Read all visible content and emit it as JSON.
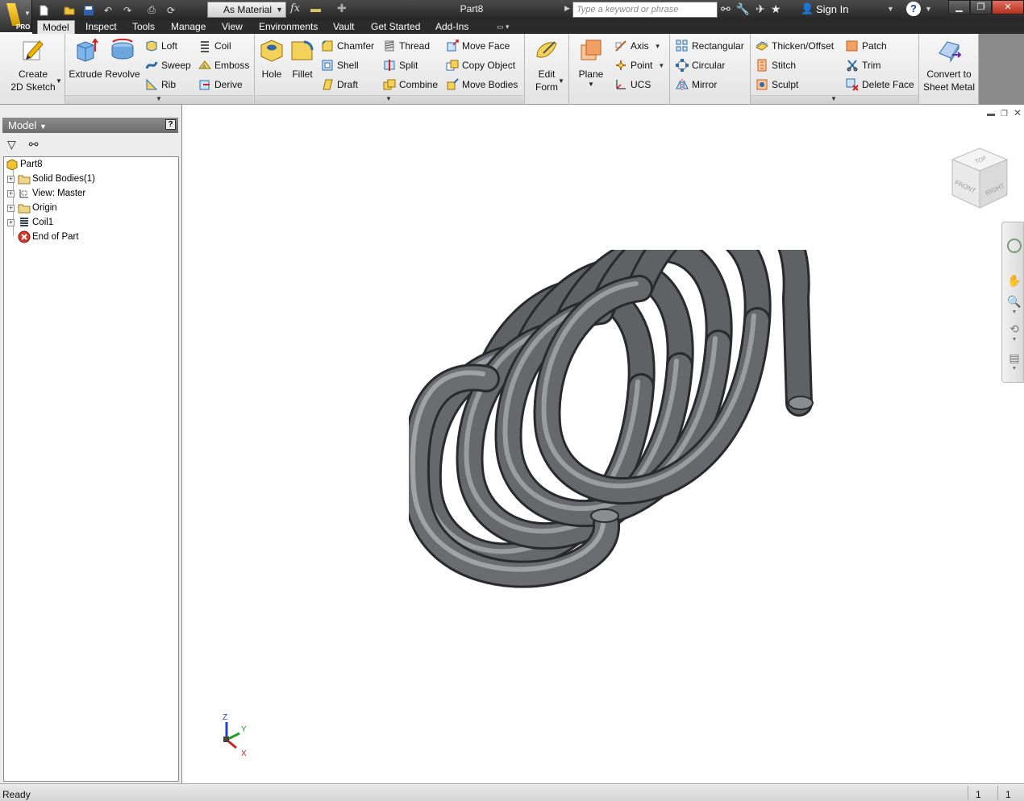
{
  "app": {
    "edition": "PRO",
    "document_title": "Part8"
  },
  "quick_access": {
    "material": "As Material",
    "search_placeholder": "Type a keyword or phrase",
    "sign_in": "Sign In",
    "help": "?"
  },
  "tabs": [
    "Model",
    "Inspect",
    "Tools",
    "Manage",
    "View",
    "Environments",
    "Vault",
    "Get Started",
    "Add-Ins"
  ],
  "ribbon": {
    "sketch": {
      "create": "Create\n2D Sketch"
    },
    "create": {
      "extrude": "Extrude",
      "revolve": "Revolve",
      "loft": "Loft",
      "sweep": "Sweep",
      "rib": "Rib",
      "coil": "Coil",
      "emboss": "Emboss",
      "derive": "Derive"
    },
    "modify": {
      "hole": "Hole",
      "fillet": "Fillet",
      "chamfer": "Chamfer",
      "shell": "Shell",
      "draft": "Draft",
      "thread": "Thread",
      "split": "Split",
      "combine": "Combine",
      "move_face": "Move Face",
      "copy_object": "Copy Object",
      "move_bodies": "Move Bodies"
    },
    "freeform": {
      "edit_form": "Edit\nForm"
    },
    "work_features": {
      "plane": "Plane",
      "axis": "Axis",
      "point": "Point",
      "ucs": "UCS"
    },
    "pattern": {
      "rectangular": "Rectangular",
      "circular": "Circular",
      "mirror": "Mirror"
    },
    "surface": {
      "thicken_offset": "Thicken/Offset",
      "stitch": "Stitch",
      "sculpt": "Sculpt",
      "patch": "Patch",
      "trim": "Trim",
      "delete_face": "Delete Face"
    },
    "convert": {
      "sheet_metal": "Convert to\nSheet Metal"
    }
  },
  "browser": {
    "title": "Model",
    "tree": [
      {
        "label": "Part8",
        "icon": "part-icon"
      },
      {
        "label": "Solid Bodies(1)",
        "icon": "folder-icon"
      },
      {
        "label": "View: Master",
        "icon": "view-icon"
      },
      {
        "label": "Origin",
        "icon": "folder-icon"
      },
      {
        "label": "Coil1",
        "icon": "coil-icon"
      },
      {
        "label": "End of Part",
        "icon": "end-of-part-icon"
      }
    ]
  },
  "viewcube": {
    "top": "TOP",
    "front": "FRONT",
    "right": "RIGHT"
  },
  "triad": {
    "x": "X",
    "y": "Y",
    "z": "Z"
  },
  "status": {
    "text": "Ready",
    "count1": "1",
    "count2": "1"
  },
  "colors": {
    "accent": "#f5c400",
    "title_bar": "#333333",
    "coil": "#5a5c60",
    "axis_x": "#d02020",
    "axis_y": "#20a020",
    "axis_z": "#2040d0"
  }
}
